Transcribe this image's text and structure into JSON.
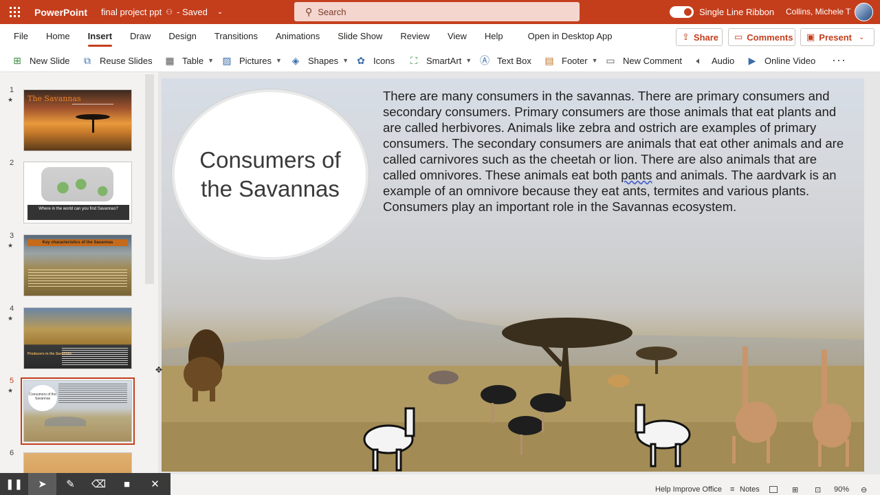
{
  "titlebar": {
    "app_name": "PowerPoint",
    "doc_name": "final project ppt",
    "saved": "- Saved",
    "search_placeholder": "Search",
    "ribbon_toggle_label": "Single Line Ribbon",
    "user_name": "Collins, Michele T"
  },
  "tabs": [
    "File",
    "Home",
    "Insert",
    "Draw",
    "Design",
    "Transitions",
    "Animations",
    "Slide Show",
    "Review",
    "View",
    "Help"
  ],
  "active_tab": "Insert",
  "open_desktop": "Open in Desktop App",
  "share_label": "Share",
  "comments_label": "Comments",
  "present_label": "Present",
  "commands": {
    "new_slide": "New Slide",
    "reuse_slides": "Reuse Slides",
    "table": "Table",
    "pictures": "Pictures",
    "shapes": "Shapes",
    "icons": "Icons",
    "smartart": "SmartArt",
    "text_box": "Text Box",
    "footer": "Footer",
    "new_comment": "New Comment",
    "audio": "Audio",
    "online_video": "Online Video"
  },
  "thumbnails": {
    "numbers": [
      "1",
      "2",
      "3",
      "4",
      "5",
      "6"
    ],
    "selected": "5",
    "t1_title": "The Savannas",
    "t2_caption": "Where in the world can you find Savannas?",
    "t3_title": "Key characteristics of the Savannas",
    "t4_label": "Producers in the Savannas",
    "t5_title": "Consumers of the Savannas"
  },
  "slide": {
    "title": "Consumers of the Savannas",
    "body_before": "There are many consumers in the savannas. There are primary consumers and secondary consumers. Primary consumers are those animals that eat plants and are called herbivores. Animals like zebra and ostrich are examples of primary consumers. The secondary consumers are animals that eat other animals and are called carnivores such as the cheetah or lion. There are also animals that are called omnivores. These animals eat both ",
    "body_misspelled": "pants",
    "body_after": " and animals. The aardvark is an example of an omnivore because they eat ants, termites and various plants. Consumers play an important role in the Savannas ecosystem."
  },
  "statusbar": {
    "help_improve": "Help Improve Office",
    "notes": "Notes",
    "zoom": "90%"
  }
}
